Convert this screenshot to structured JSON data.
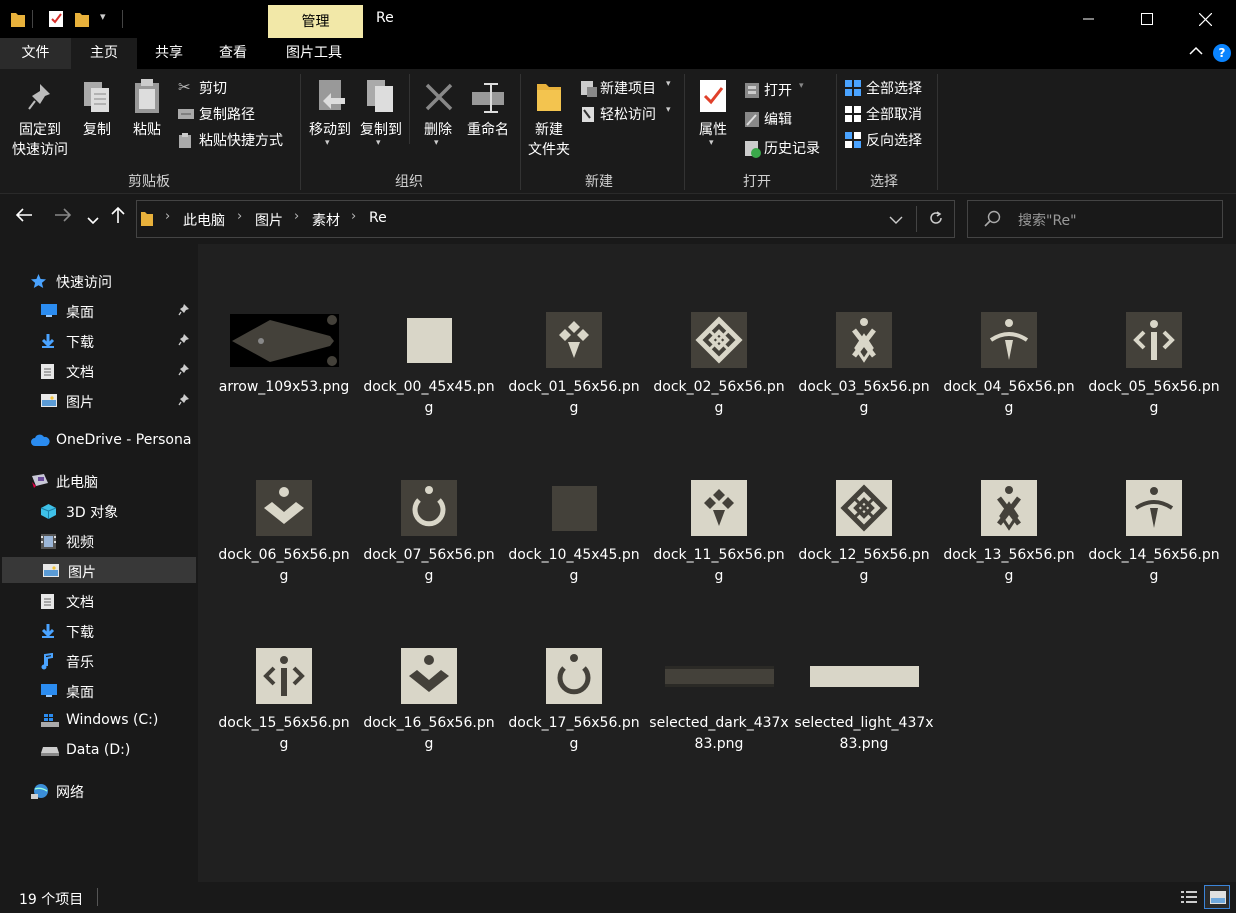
{
  "window": {
    "title": "Re",
    "context_tab": "管理",
    "controls": [
      "—",
      "☐",
      "✕"
    ]
  },
  "ribbon": {
    "tabs": [
      "文件",
      "主页",
      "共享",
      "查看",
      "图片工具"
    ],
    "active_tab": "主页",
    "clipboard": {
      "pin_line1": "固定到",
      "pin_line2": "快速访问",
      "copy": "复制",
      "paste": "粘贴",
      "cut": "剪切",
      "copy_path": "复制路径",
      "paste_shortcut": "粘贴快捷方式",
      "label": "剪贴板"
    },
    "organize": {
      "move_to": "移动到",
      "copy_to": "复制到",
      "delete": "删除",
      "rename": "重命名",
      "label": "组织"
    },
    "new": {
      "new_folder_line1": "新建",
      "new_folder_line2": "文件夹",
      "new_item": "新建项目",
      "easy_access": "轻松访问",
      "label": "新建"
    },
    "open": {
      "properties": "属性",
      "open": "打开",
      "edit": "编辑",
      "history": "历史记录",
      "label": "打开"
    },
    "select": {
      "select_all": "全部选择",
      "select_none": "全部取消",
      "invert": "反向选择",
      "label": "选择"
    }
  },
  "address": {
    "breadcrumb": [
      "此电脑",
      "图片",
      "素材",
      "Re"
    ],
    "search_placeholder": "搜索\"Re\""
  },
  "sidebar": {
    "items": [
      {
        "label": "快速访问",
        "icon": "star-icon",
        "pinned": false
      },
      {
        "label": "桌面",
        "icon": "desktop-icon",
        "pinned": true
      },
      {
        "label": "下载",
        "icon": "download-icon",
        "pinned": true
      },
      {
        "label": "文档",
        "icon": "document-icon",
        "pinned": true
      },
      {
        "label": "图片",
        "icon": "picture-icon",
        "pinned": true
      },
      {
        "label": "OneDrive - Persona",
        "icon": "cloud-icon",
        "pinned": false
      },
      {
        "label": "此电脑",
        "icon": "pc-icon",
        "pinned": false
      },
      {
        "label": "3D 对象",
        "icon": "cube-icon",
        "pinned": false
      },
      {
        "label": "视频",
        "icon": "video-icon",
        "pinned": false
      },
      {
        "label": "图片",
        "icon": "picture-icon",
        "pinned": false,
        "selected": true
      },
      {
        "label": "文档",
        "icon": "document-icon",
        "pinned": false
      },
      {
        "label": "下载",
        "icon": "download-icon",
        "pinned": false
      },
      {
        "label": "音乐",
        "icon": "music-icon",
        "pinned": false
      },
      {
        "label": "桌面",
        "icon": "desktop-icon",
        "pinned": false
      },
      {
        "label": "Windows (C:)",
        "icon": "windows-drive-icon",
        "pinned": false
      },
      {
        "label": "Data (D:)",
        "icon": "drive-icon",
        "pinned": false
      },
      {
        "label": "网络",
        "icon": "network-icon",
        "pinned": false
      }
    ]
  },
  "files": [
    {
      "name": "arrow_109x53.png",
      "thumb": "arrow"
    },
    {
      "name": "dock_00_45x45.png",
      "thumb": "light-square"
    },
    {
      "name": "dock_01_56x56.png",
      "thumb": "dark-diamonds"
    },
    {
      "name": "dock_02_56x56.png",
      "thumb": "dark-grid-diamond"
    },
    {
      "name": "dock_03_56x56.png",
      "thumb": "dark-figure-x"
    },
    {
      "name": "dock_04_56x56.png",
      "thumb": "dark-figure-arc"
    },
    {
      "name": "dock_05_56x56.png",
      "thumb": "dark-code"
    },
    {
      "name": "dock_06_56x56.png",
      "thumb": "dark-chevron"
    },
    {
      "name": "dock_07_56x56.png",
      "thumb": "dark-power"
    },
    {
      "name": "dock_10_45x45.png",
      "thumb": "dark-square"
    },
    {
      "name": "dock_11_56x56.png",
      "thumb": "light-diamonds"
    },
    {
      "name": "dock_12_56x56.png",
      "thumb": "light-grid-diamond"
    },
    {
      "name": "dock_13_56x56.png",
      "thumb": "light-figure-x"
    },
    {
      "name": "dock_14_56x56.png",
      "thumb": "light-figure-arc"
    },
    {
      "name": "dock_15_56x56.png",
      "thumb": "light-code"
    },
    {
      "name": "dock_16_56x56.png",
      "thumb": "light-chevron"
    },
    {
      "name": "dock_17_56x56.png",
      "thumb": "light-power"
    },
    {
      "name": "selected_dark_437x83.png",
      "thumb": "dark-bar"
    },
    {
      "name": "selected_light_437x83.png",
      "thumb": "light-bar"
    }
  ],
  "status": {
    "item_count": "19 个项目"
  },
  "colors": {
    "dark_tile": "#44413a",
    "light_tile": "#d9d6c8",
    "context_tab": "#f2e8a8",
    "accent": "#0a84ff"
  }
}
